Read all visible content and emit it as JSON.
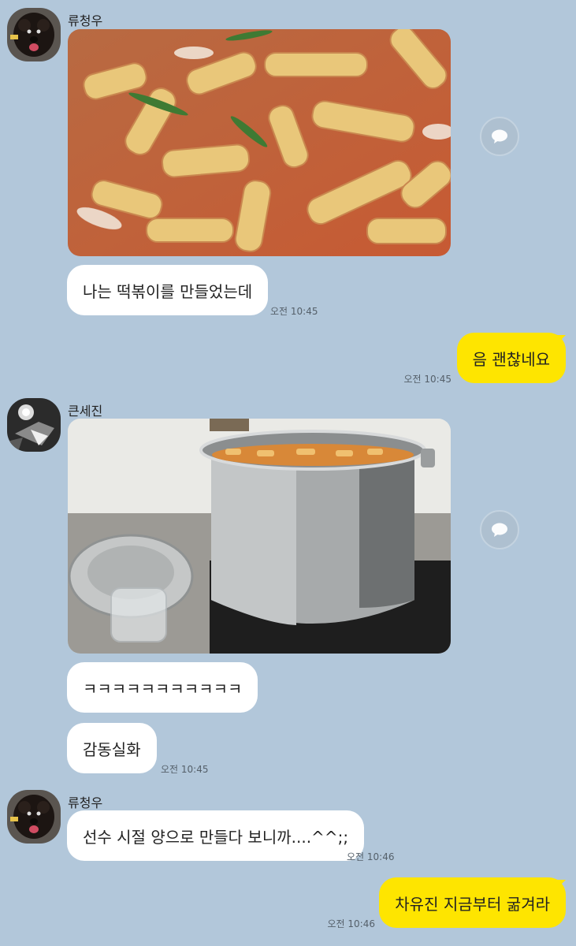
{
  "messages": [
    {
      "sender": "류청우",
      "kind": "photo",
      "photo": "tteokbokki-close-up"
    },
    {
      "kind": "text",
      "text": "나는 떡볶이를 만들었는데",
      "time": "오전 10:45"
    },
    {
      "kind": "text",
      "direction": "out",
      "text": "음 괜찮네요",
      "time": "오전 10:45"
    },
    {
      "sender": "큰세진",
      "kind": "photo",
      "photo": "stainless-pot-of-tteokbokki"
    },
    {
      "kind": "text",
      "text": "ㅋㅋㅋㅋㅋㅋㅋㅋㅋㅋㅋ"
    },
    {
      "kind": "text",
      "text": "감동실화",
      "time": "오전 10:45"
    },
    {
      "sender": "류청우",
      "kind": "text",
      "text": "선수 시절 양으로 만들다 보니까....^^;;",
      "time": "오전 10:46"
    },
    {
      "kind": "text",
      "direction": "out",
      "text": "차유진 지금부터 굶겨라",
      "time": "오전 10:46"
    }
  ],
  "icons": {
    "share": "speech-bubble-icon"
  },
  "colors": {
    "background": "#b2c7da",
    "incoming_bubble": "#ffffff",
    "outgoing_bubble": "#fee500"
  }
}
